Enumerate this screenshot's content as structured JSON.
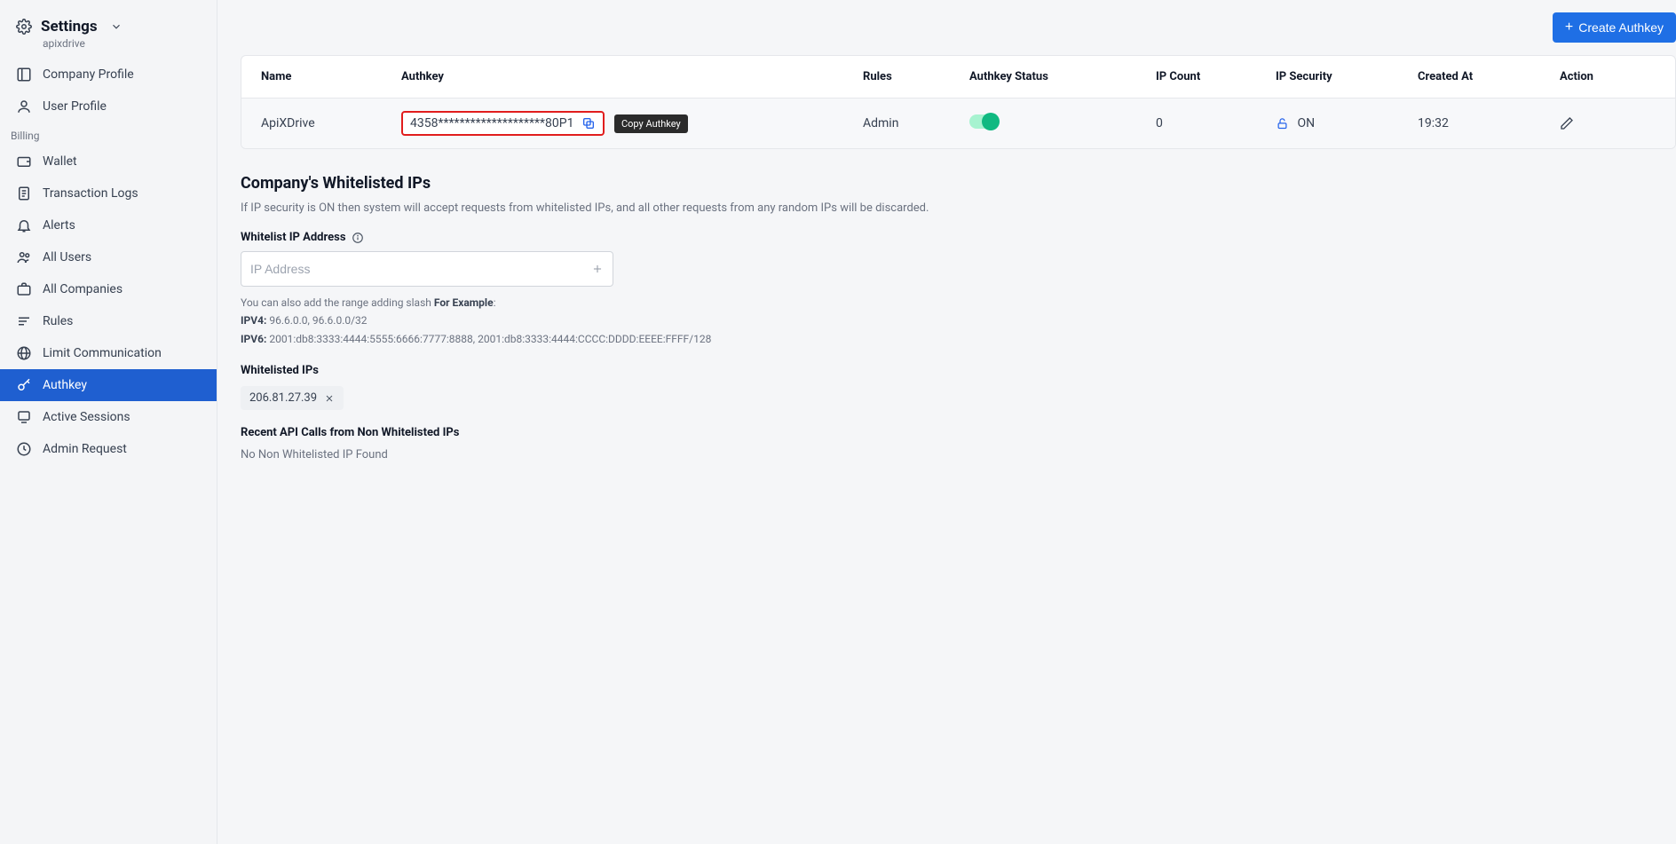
{
  "sidebar": {
    "title": "Settings",
    "subtitle": "apixdrive",
    "group_nav": [
      {
        "icon": "layout",
        "label": "Company Profile"
      },
      {
        "icon": "user",
        "label": "User Profile"
      }
    ],
    "billing_label": "Billing",
    "billing_nav": [
      {
        "icon": "wallet",
        "label": "Wallet"
      },
      {
        "icon": "doc",
        "label": "Transaction Logs"
      },
      {
        "icon": "bell",
        "label": "Alerts"
      },
      {
        "icon": "users",
        "label": "All Users"
      },
      {
        "icon": "briefcase",
        "label": "All Companies"
      },
      {
        "icon": "rules",
        "label": "Rules"
      },
      {
        "icon": "globe",
        "label": "Limit Communication"
      },
      {
        "icon": "key",
        "label": "Authkey",
        "active": true
      },
      {
        "icon": "sessions",
        "label": "Active Sessions"
      },
      {
        "icon": "admin",
        "label": "Admin Request"
      }
    ]
  },
  "topbar": {
    "create_label": "Create Authkey"
  },
  "table": {
    "headers": {
      "name": "Name",
      "authkey": "Authkey",
      "rules": "Rules",
      "status": "Authkey Status",
      "ipcount": "IP Count",
      "ipsec": "IP Security",
      "created": "Created At",
      "action": "Action"
    },
    "row": {
      "name": "ApiXDrive",
      "authkey": "4358********************80P1",
      "tooltip": "Copy Authkey",
      "rules": "Admin",
      "ipcount": "0",
      "ipsec": "ON",
      "created": "19:32"
    }
  },
  "whitelist": {
    "title": "Company's Whitelisted IPs",
    "desc": "If IP security is ON then system will accept requests from whitelisted IPs, and all other requests from any random IPs will be discarded.",
    "field_label": "Whitelist IP Address",
    "placeholder": "IP Address",
    "helper_intro": "You can also add the range adding slash ",
    "helper_example_label": "For Example",
    "ipv4_label": "IPV4:",
    "ipv4_ex": " 96.6.0.0, 96.6.0.0/32",
    "ipv6_label": "IPV6:",
    "ipv6_ex": " 2001:db8:3333:4444:5555:6666:7777:8888, 2001:db8:3333:4444:CCCC:DDDD:EEEE:FFFF/128",
    "list_heading": "Whitelisted IPs",
    "chip": "206.81.27.39",
    "recent_heading": "Recent API Calls from Non Whitelisted IPs",
    "recent_empty": "No Non Whitelisted IP Found"
  }
}
